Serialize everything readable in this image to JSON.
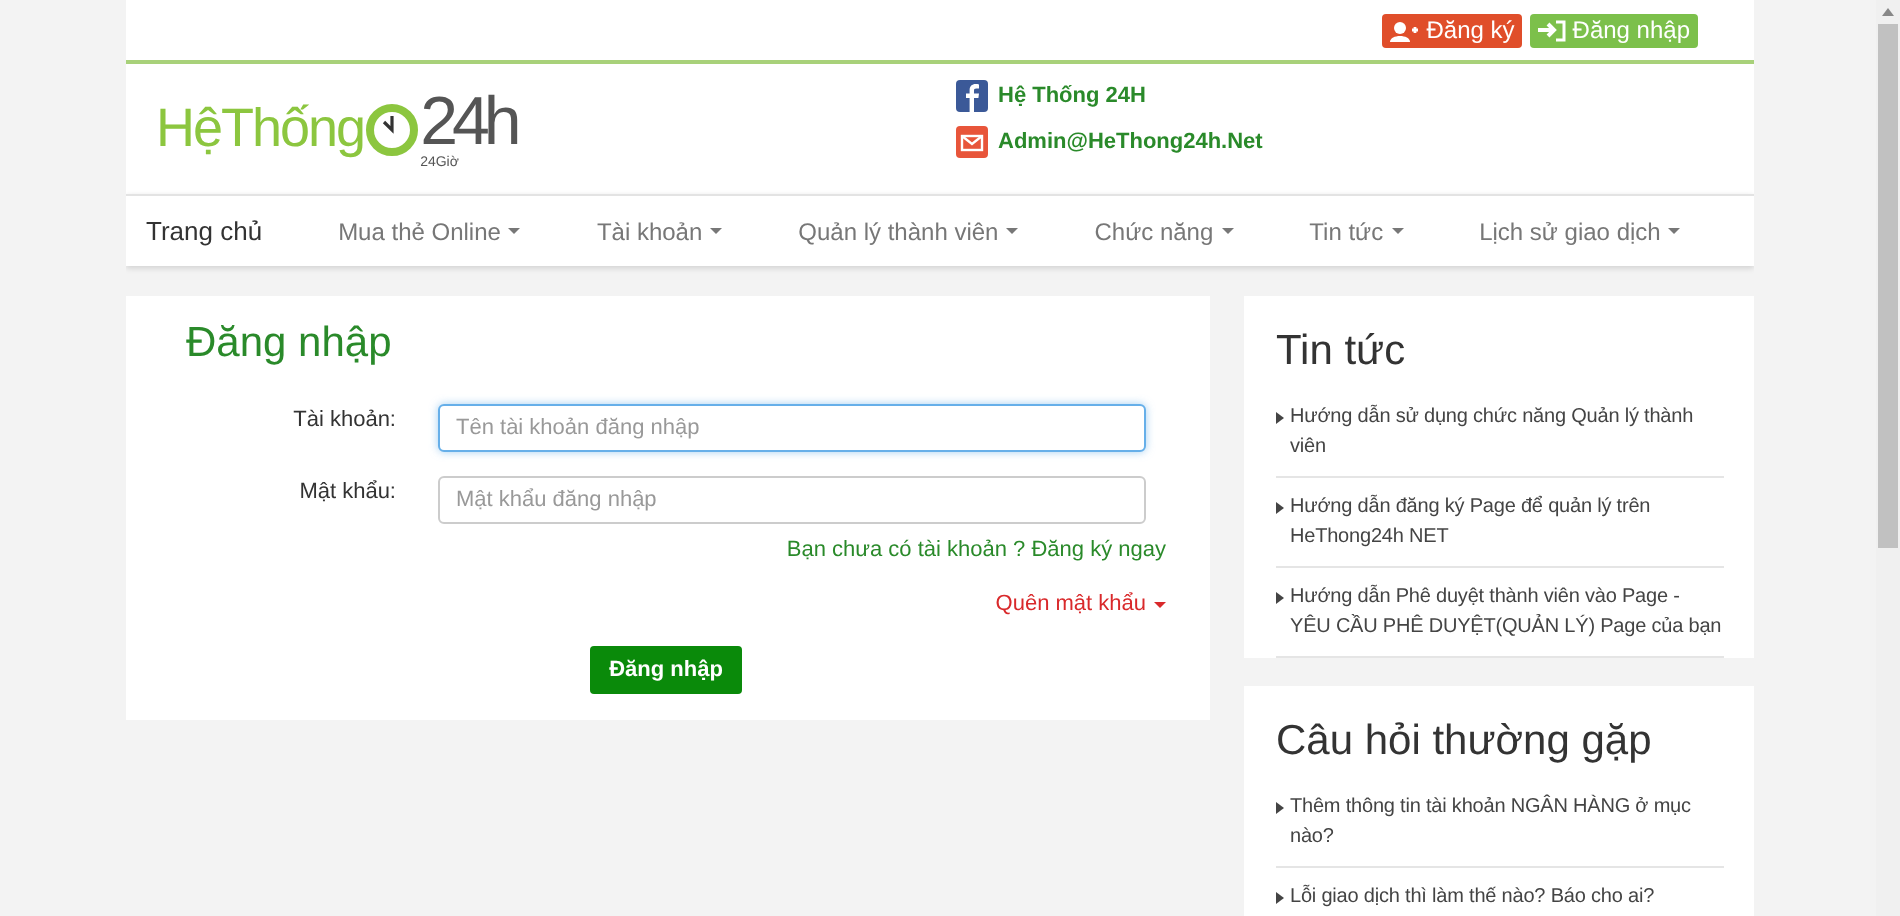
{
  "top_buttons": [
    {
      "kind": "register",
      "label": "Đăng ký"
    },
    {
      "kind": "login",
      "label": "Đăng nhập"
    }
  ],
  "logo": {
    "name": "HệThống",
    "digits": "24h",
    "tagline": "24Giờ"
  },
  "contacts": [
    {
      "kind": "facebook",
      "text": "Hệ Thống 24H"
    },
    {
      "kind": "email",
      "text": "Admin@HeThong24h.Net"
    }
  ],
  "nav": [
    {
      "label": "Trang chủ",
      "selected": true,
      "dropdown": false
    },
    {
      "label": "Mua thẻ Online",
      "selected": false,
      "dropdown": true
    },
    {
      "label": "Tài khoản",
      "selected": false,
      "dropdown": true
    },
    {
      "label": "Quản lý thành viên",
      "selected": false,
      "dropdown": true
    },
    {
      "label": "Chức năng",
      "selected": false,
      "dropdown": true
    },
    {
      "label": "Tin tức",
      "selected": false,
      "dropdown": true
    },
    {
      "label": "Lịch sử giao dịch",
      "selected": false,
      "dropdown": true
    }
  ],
  "login": {
    "title": "Đăng nhập",
    "fields": [
      {
        "label": "Tài khoản:",
        "placeholder": "Tên tài khoản đăng nhập",
        "focused": true
      },
      {
        "label": "Mật khẩu:",
        "placeholder": "Mật khẩu đăng nhập",
        "focused": false
      }
    ],
    "register_link": "Bạn chưa có tài khoản ? Đăng ký ngay",
    "forgot_link": "Quên mật khẩu",
    "submit": "Đăng nhập"
  },
  "sidebar": [
    {
      "title": "Tin tức",
      "items": [
        "Hướng dẫn sử dụng chức năng Quản lý thành viên",
        "Hướng dẫn đăng ký Page để quản lý trên HeThong24h NET",
        "Hướng dẫn Phê duyệt thành viên vào Page - YÊU CẦU PHÊ DUYỆT(QUẢN LÝ) Page của bạn"
      ]
    },
    {
      "title": "Câu hỏi thường gặp",
      "items": [
        "Thêm thông tin tài khoản NGÂN HÀNG ở mục nào?",
        "Lỗi giao dịch thì làm thế nào? Báo cho ai?"
      ]
    }
  ]
}
